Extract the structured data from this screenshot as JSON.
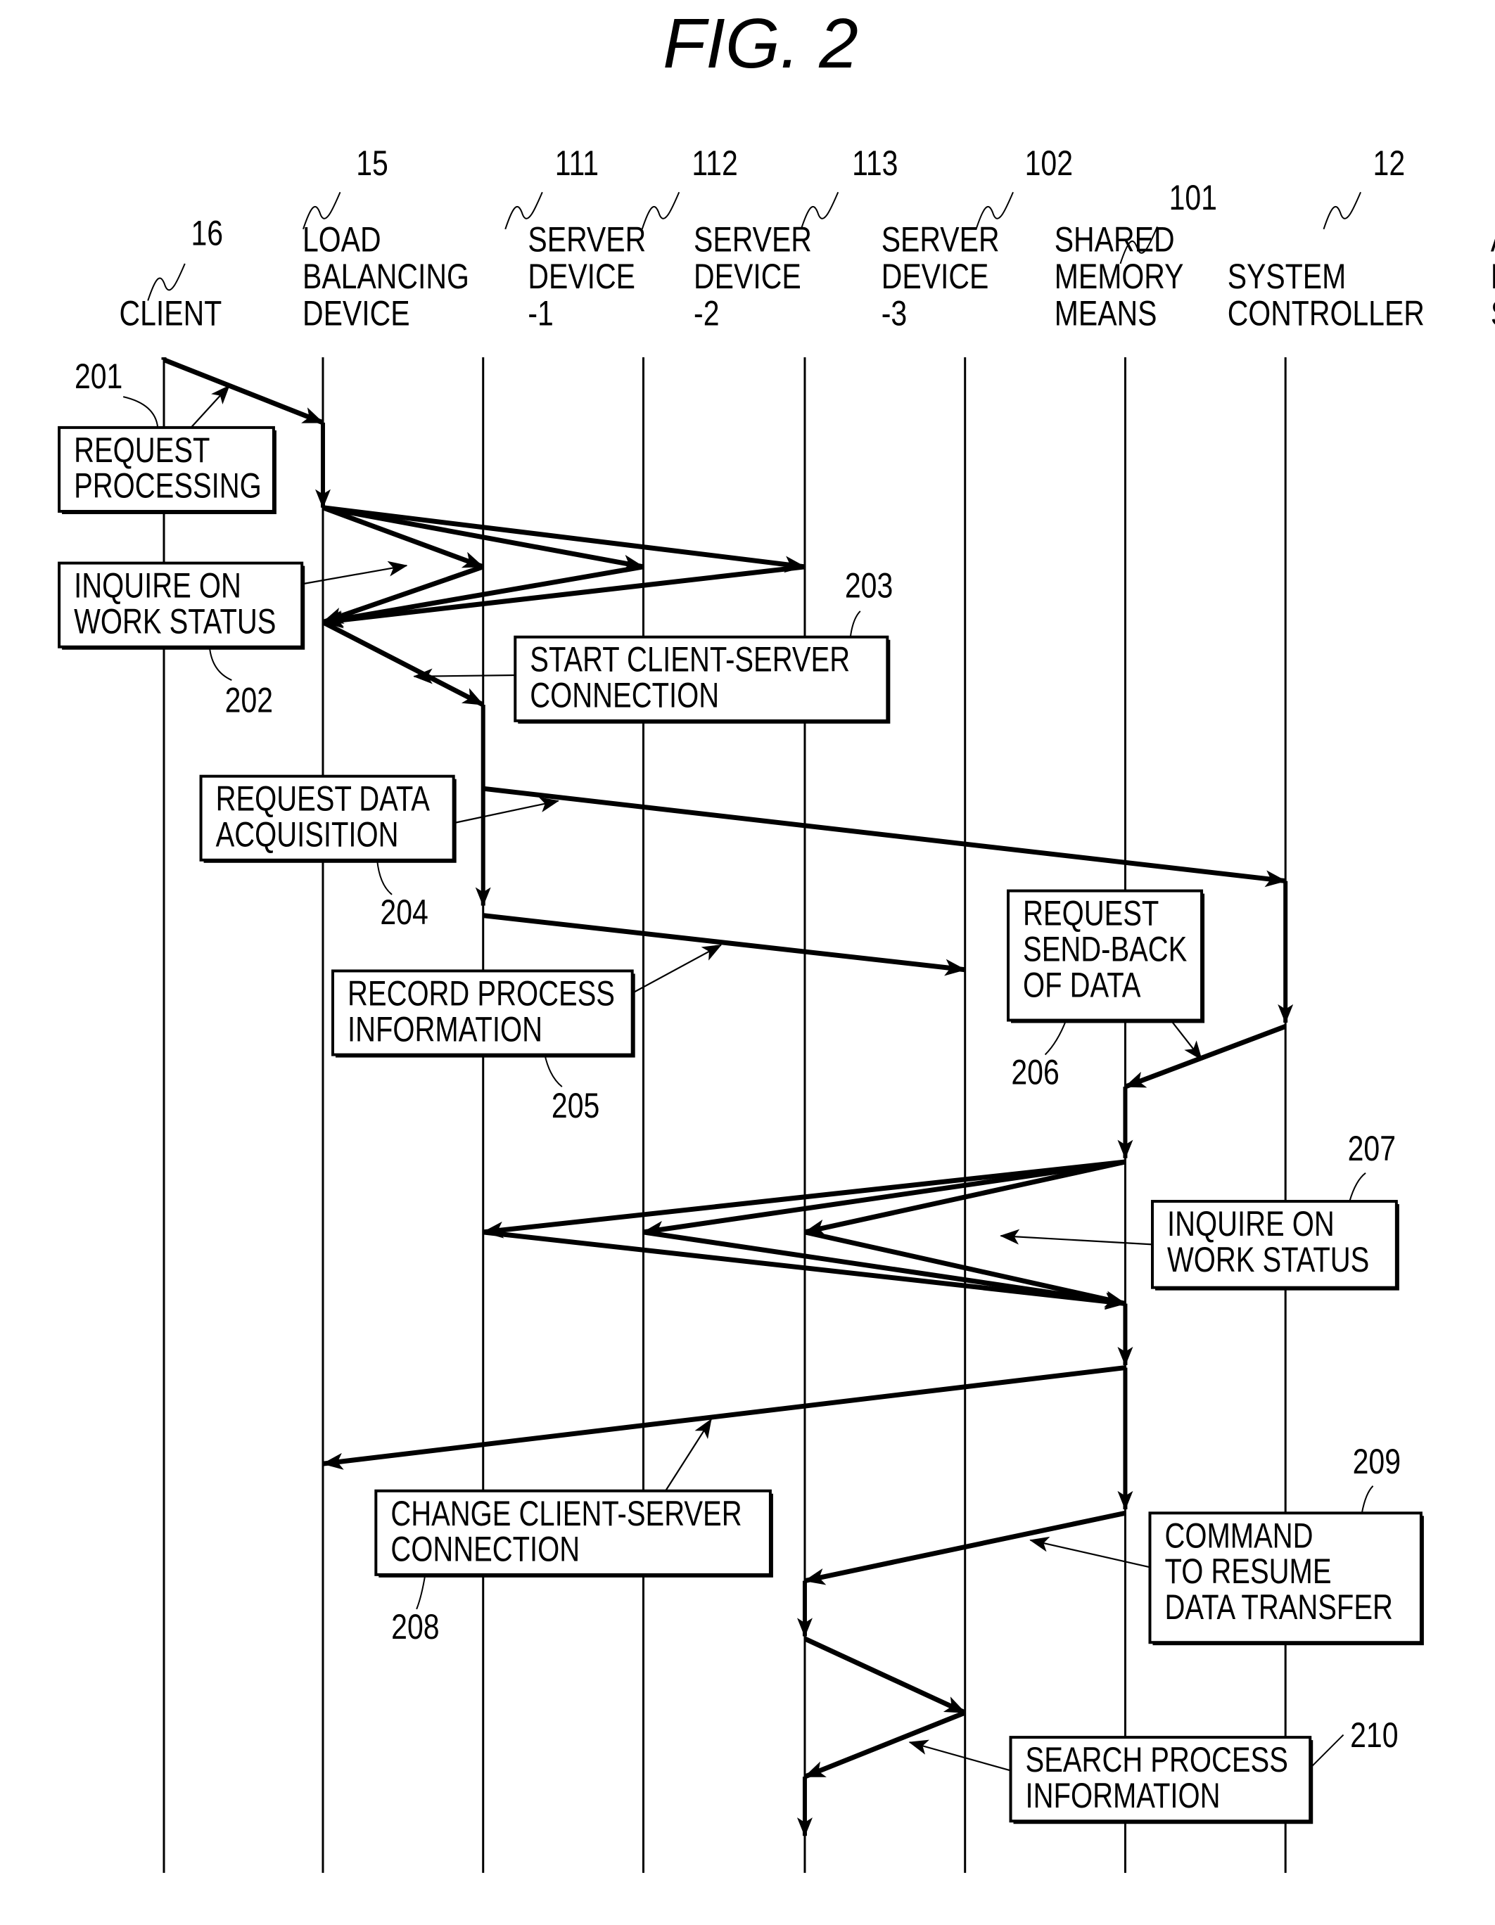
{
  "figure": {
    "title": "FIG. 2"
  },
  "lifelines": [
    {
      "id": "client",
      "ref": "16",
      "lines": [
        "CLIENT"
      ]
    },
    {
      "id": "load-balancer",
      "ref": "15",
      "lines": [
        "LOAD",
        "BALANCING",
        "DEVICE"
      ]
    },
    {
      "id": "server-1",
      "ref": "111",
      "lines": [
        "SERVER",
        "DEVICE",
        "-1"
      ]
    },
    {
      "id": "server-2",
      "ref": "112",
      "lines": [
        "SERVER",
        "DEVICE",
        "-2"
      ]
    },
    {
      "id": "server-3",
      "ref": "113",
      "lines": [
        "SERVER",
        "DEVICE",
        "-3"
      ]
    },
    {
      "id": "shared-memory",
      "ref": "102",
      "lines": [
        "SHARED",
        "MEMORY",
        "MEANS"
      ]
    },
    {
      "id": "system-controller",
      "ref": "101",
      "lines": [
        "SYSTEM",
        "CONTROLLER"
      ]
    },
    {
      "id": "app-server",
      "ref": "12",
      "lines": [
        "APPLICATION",
        "LAYER",
        "SERVER"
      ]
    }
  ],
  "steps": [
    {
      "ref": "201",
      "lines": [
        "REQUEST",
        "PROCESSING"
      ]
    },
    {
      "ref": "202",
      "lines": [
        "INQUIRE  ON",
        "WORK  STATUS"
      ]
    },
    {
      "ref": "203",
      "lines": [
        "START  CLIENT-SERVER",
        "CONNECTION"
      ]
    },
    {
      "ref": "204",
      "lines": [
        "REQUEST  DATA",
        "ACQUISITION"
      ]
    },
    {
      "ref": "205",
      "lines": [
        "RECORD  PROCESS",
        "INFORMATION"
      ]
    },
    {
      "ref": "206",
      "lines": [
        "REQUEST",
        "SEND-BACK",
        "OF  DATA"
      ]
    },
    {
      "ref": "207",
      "lines": [
        "INQUIRE  ON",
        "WORK  STATUS"
      ]
    },
    {
      "ref": "208",
      "lines": [
        "CHANGE  CLIENT-SERVER",
        "CONNECTION"
      ]
    },
    {
      "ref": "209",
      "lines": [
        "COMMAND",
        "TO  RESUME",
        "DATA  TRANSFER"
      ]
    },
    {
      "ref": "210",
      "lines": [
        "SEARCH  PROCESS",
        "INFORMATION"
      ]
    }
  ],
  "messages": [
    {
      "from": "client",
      "to": "load-balancer",
      "step": "201"
    },
    {
      "from": "load-balancer",
      "to": "server-1",
      "step": "202"
    },
    {
      "from": "load-balancer",
      "to": "server-2",
      "step": "202"
    },
    {
      "from": "load-balancer",
      "to": "server-3",
      "step": "202"
    },
    {
      "from": "server-1",
      "to": "load-balancer",
      "step": "202"
    },
    {
      "from": "server-2",
      "to": "load-balancer",
      "step": "202"
    },
    {
      "from": "server-3",
      "to": "load-balancer",
      "step": "202"
    },
    {
      "from": "load-balancer",
      "to": "server-1",
      "step": "203"
    },
    {
      "from": "server-1",
      "to": "app-server",
      "step": "204"
    },
    {
      "from": "server-1",
      "to": "shared-memory",
      "step": "205"
    },
    {
      "from": "app-server",
      "to": "system-controller",
      "step": "206"
    },
    {
      "from": "system-controller",
      "to": "server-1",
      "step": "207"
    },
    {
      "from": "system-controller",
      "to": "server-2",
      "step": "207"
    },
    {
      "from": "system-controller",
      "to": "server-3",
      "step": "207"
    },
    {
      "from": "server-1",
      "to": "system-controller",
      "step": "207"
    },
    {
      "from": "server-2",
      "to": "system-controller",
      "step": "207"
    },
    {
      "from": "server-3",
      "to": "system-controller",
      "step": "207"
    },
    {
      "from": "system-controller",
      "to": "load-balancer",
      "step": "208"
    },
    {
      "from": "system-controller",
      "to": "server-3",
      "step": "209"
    },
    {
      "from": "server-3",
      "to": "shared-memory",
      "step": "210"
    },
    {
      "from": "shared-memory",
      "to": "server-3",
      "step": "210"
    }
  ]
}
